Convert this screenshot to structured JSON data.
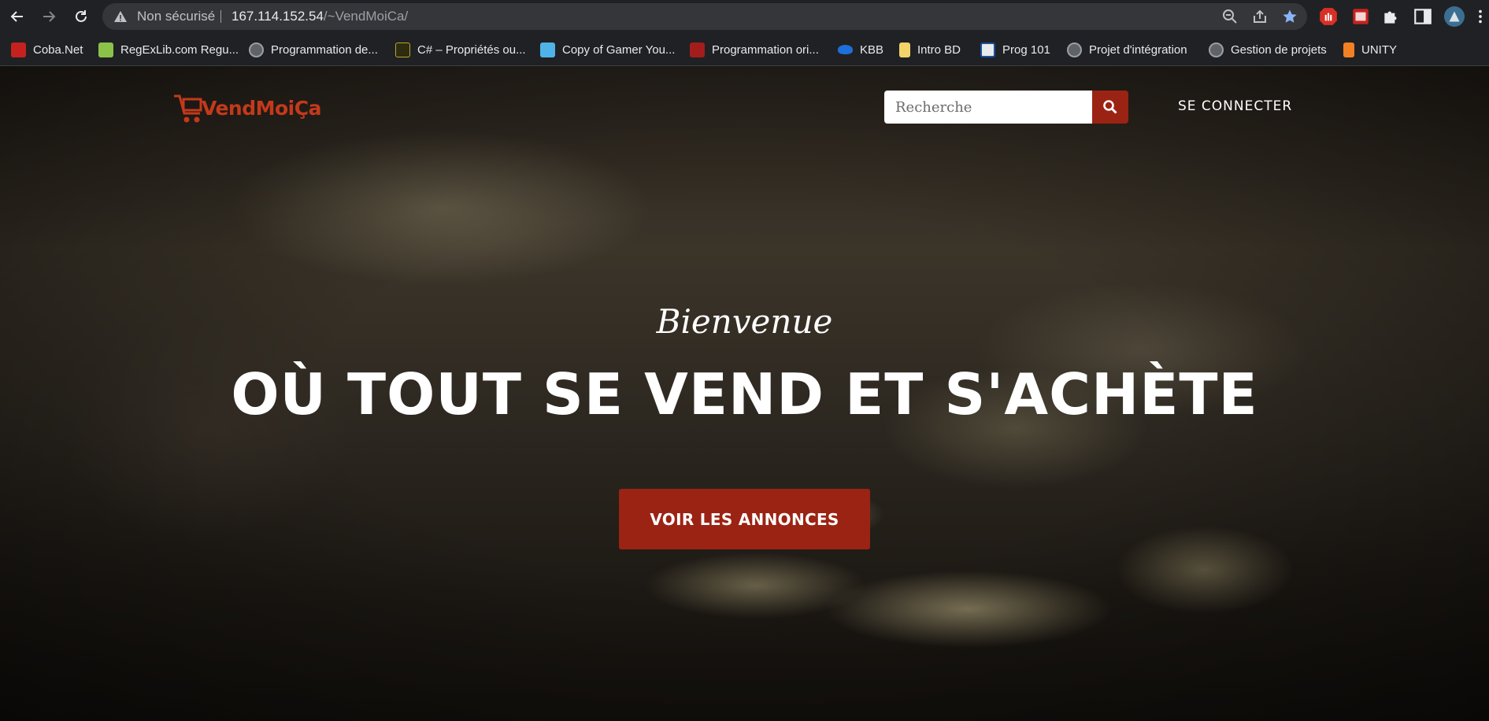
{
  "browser": {
    "security_status": "Non sécurisé",
    "url_host": "167.114.152.54",
    "url_path": "/~VendMoiCa/",
    "bookmarks": [
      {
        "label": "Coba.Net",
        "icon": "coba-favicon"
      },
      {
        "label": "RegExLib.com Regu...",
        "icon": "regexlib-favicon"
      },
      {
        "label": "Programmation de...",
        "icon": "globe-icon"
      },
      {
        "label": "C# – Propriétés ou...",
        "icon": "csharp-favicon"
      },
      {
        "label": "Copy of Gamer You...",
        "icon": "sheets-favicon"
      },
      {
        "label": "Programmation ori...",
        "icon": "oop-favicon"
      },
      {
        "label": "KBB",
        "icon": "onedrive-icon"
      },
      {
        "label": "Intro BD",
        "icon": "folder-icon"
      },
      {
        "label": "Prog 101",
        "icon": "p-favicon"
      },
      {
        "label": "Projet d'intégration",
        "icon": "globe-icon"
      },
      {
        "label": "Gestion de projets",
        "icon": "globe-icon"
      },
      {
        "label": "UNITY",
        "icon": "stackoverflow-icon"
      }
    ]
  },
  "site": {
    "logo_text": "VendMoiÇa",
    "search_placeholder": "Recherche",
    "login_label": "SE CONNECTER",
    "hero_subtitle": "Bienvenue",
    "hero_title": "OÙ TOUT SE VEND ET S'ACHÈTE",
    "cta_label": "VOIR LES ANNONCES"
  },
  "colors": {
    "accent": "#9b2313",
    "logo": "#c4391b",
    "chrome_bg": "#202124",
    "omnibox_bg": "#35363a"
  }
}
